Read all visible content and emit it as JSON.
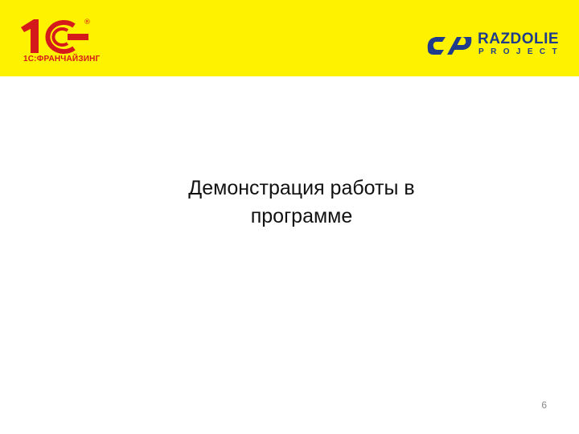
{
  "header": {
    "logo_1c": {
      "mark": "1С",
      "registered": "®",
      "caption": "1С:ФРАНЧАЙЗИНГ",
      "color": "#d41a1a"
    },
    "logo_partner": {
      "name": "RAZDOLIE",
      "sub": "PROJECT",
      "color": "#1f3c8c"
    },
    "background": "#fff200"
  },
  "slide": {
    "title_line1": "Демонстрация работы в",
    "title_line2": "программе",
    "page_number": "6"
  }
}
